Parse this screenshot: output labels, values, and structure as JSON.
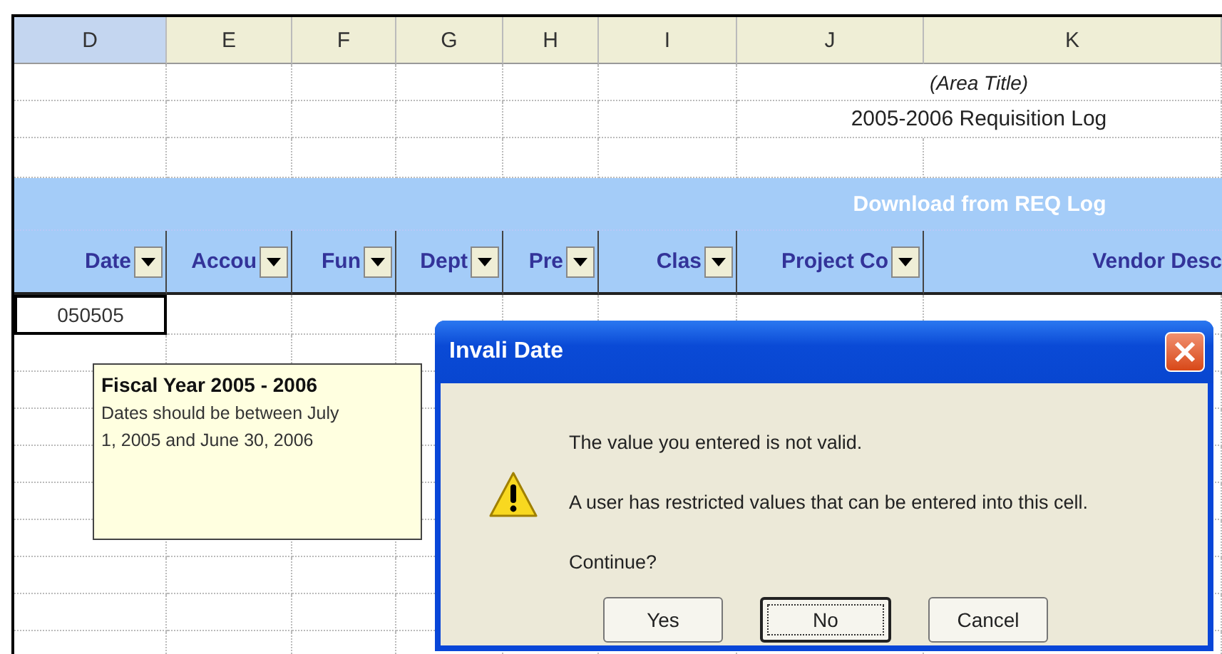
{
  "column_headers": [
    {
      "label": "D",
      "selected": true
    },
    {
      "label": "E",
      "selected": false
    },
    {
      "label": "F",
      "selected": false
    },
    {
      "label": "G",
      "selected": false
    },
    {
      "label": "H",
      "selected": false
    },
    {
      "label": "I",
      "selected": false
    },
    {
      "label": "J",
      "selected": false
    },
    {
      "label": "K",
      "selected": false
    }
  ],
  "area_title": "(Area Title)",
  "log_title": "2005-2006 Requisition Log",
  "banner": "Download from REQ Log",
  "fields": [
    {
      "label": "Date",
      "filter": true
    },
    {
      "label": "Accou",
      "filter": true
    },
    {
      "label": "Fun",
      "filter": true
    },
    {
      "label": "Dept",
      "filter": true
    },
    {
      "label": "Pre",
      "filter": true
    },
    {
      "label": "Clas",
      "filter": true
    },
    {
      "label": "Project Co",
      "filter": true
    },
    {
      "label": "Vendor Desc",
      "filter": false
    }
  ],
  "active_cell": {
    "value": "050505"
  },
  "input_message": {
    "title": "Fiscal Year 2005 - 2006",
    "text": "Dates should be between July 1, 2005 and June 30, 2006"
  },
  "dialog": {
    "title": "Invali Date",
    "messages": [
      "The value you entered is not valid.",
      "A user has restricted values that can be entered into this cell.",
      "Continue?"
    ],
    "buttons": [
      {
        "label": "Yes",
        "default": false
      },
      {
        "label": "No",
        "default": true
      },
      {
        "label": "Cancel",
        "default": false
      }
    ]
  }
}
